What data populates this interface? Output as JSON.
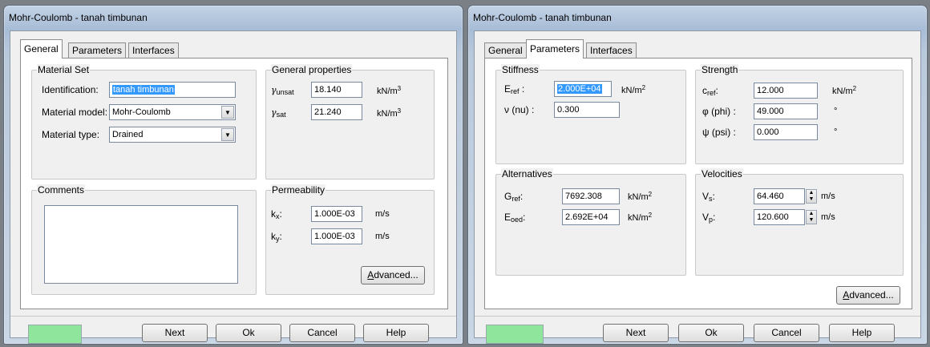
{
  "window1": {
    "title": "Mohr-Coulomb - tanah timbunan",
    "tabs": [
      "General",
      "Parameters",
      "Interfaces"
    ],
    "material_set": {
      "label": "Material Set",
      "identification_label": "Identification:",
      "identification_value": "tanah timbunan",
      "model_label": "Material model:",
      "model_value": "Mohr-Coulomb",
      "type_label": "Material type:",
      "type_value": "Drained"
    },
    "general_properties": {
      "label": "General properties",
      "gamma_unsat_symbol": "γ",
      "gamma_unsat_sub": "unsat",
      "gamma_unsat_value": "18.140",
      "gamma_sat_symbol": "γ",
      "gamma_sat_sub": "sat",
      "gamma_sat_value": "21.240",
      "unit_base": "kN/m",
      "unit_exp": "3"
    },
    "comments": {
      "label": "Comments"
    },
    "permeability": {
      "label": "Permeability",
      "kx_base": "k",
      "kx_sub": "x",
      "kx_value": "1.000E-03",
      "ky_base": "k",
      "ky_sub": "y",
      "ky_value": "1.000E-03",
      "colon": ":",
      "unit": "m/s"
    },
    "advanced_label": "Advanced...",
    "buttons": {
      "next": "Next",
      "ok": "Ok",
      "cancel": "Cancel",
      "help": "Help"
    }
  },
  "window2": {
    "title": "Mohr-Coulomb - tanah timbunan",
    "tabs": [
      "General",
      "Parameters",
      "Interfaces"
    ],
    "stiffness": {
      "label": "Stiffness",
      "eref_base": "E",
      "eref_sub": "ref",
      "eref_value": "2.000E+04",
      "nu_label": "ν (nu) :",
      "nu_value": "0.300",
      "unit_base": "kN/m",
      "unit_exp": "2"
    },
    "strength": {
      "label": "Strength",
      "cref_base": "c",
      "cref_sub": "ref",
      "cref_value": "12.000",
      "phi_label": "φ (phi) :",
      "phi_value": "49.000",
      "psi_label": "ψ (psi) :",
      "psi_value": "0.000",
      "unit_base": "kN/m",
      "unit_exp": "2",
      "deg": "°"
    },
    "alternatives": {
      "label": "Alternatives",
      "gref_base": "G",
      "gref_sub": "ref",
      "gref_value": "7692.308",
      "eoed_base": "E",
      "eoed_sub": "oed",
      "eoed_value": "2.692E+04",
      "unit_base": "kN/m",
      "unit_exp": "2"
    },
    "velocities": {
      "label": "Velocities",
      "vs_base": "V",
      "vs_sub": "s",
      "vs_value": "64.460",
      "vp_base": "V",
      "vp_sub": "p",
      "vp_value": "120.600",
      "unit": "m/s"
    },
    "colon": ":",
    "advanced_label": "Advanced...",
    "buttons": {
      "next": "Next",
      "ok": "Ok",
      "cancel": "Cancel",
      "help": "Help"
    }
  },
  "colors": {
    "green_indicator": "#8fe59c",
    "selection": "#3399ff"
  }
}
